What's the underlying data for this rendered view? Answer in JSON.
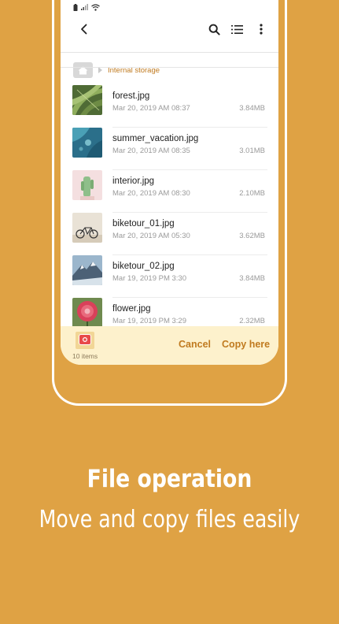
{
  "breadcrumb": {
    "location": "Internal storage"
  },
  "files": [
    {
      "name": "forest.jpg",
      "date": "Mar 20, 2019 AM 08:37",
      "size": "3.84MB",
      "thumb": "forest"
    },
    {
      "name": "summer_vacation.jpg",
      "date": "Mar 20, 2019 AM 08:35",
      "size": "3.01MB",
      "thumb": "sea"
    },
    {
      "name": "interior.jpg",
      "date": "Mar 20, 2019 AM 08:30",
      "size": "2.10MB",
      "thumb": "interior"
    },
    {
      "name": "biketour_01.jpg",
      "date": "Mar 20, 2019 AM 05:30",
      "size": "3.62MB",
      "thumb": "bike"
    },
    {
      "name": "biketour_02.jpg",
      "date": "Mar 19, 2019 PM 3:30",
      "size": "3.84MB",
      "thumb": "mountain"
    },
    {
      "name": "flower.jpg",
      "date": "Mar 19, 2019 PM 3:29",
      "size": "2.32MB",
      "thumb": "flower"
    }
  ],
  "bottom_bar": {
    "items_count": "10 items",
    "cancel_label": "Cancel",
    "copy_label": "Copy here"
  },
  "promo": {
    "headline": "File operation",
    "subline": "Move and copy files easily"
  },
  "colors": {
    "background": "#DFA244",
    "accent": "#C07A1F",
    "bottom_bar": "#FDF1CC"
  },
  "icons": [
    "battery-icon",
    "signal-icon",
    "wifi-icon",
    "back-arrow-icon",
    "search-icon",
    "list-view-icon",
    "more-options-icon",
    "home-folder-icon",
    "clipboard-icon"
  ]
}
